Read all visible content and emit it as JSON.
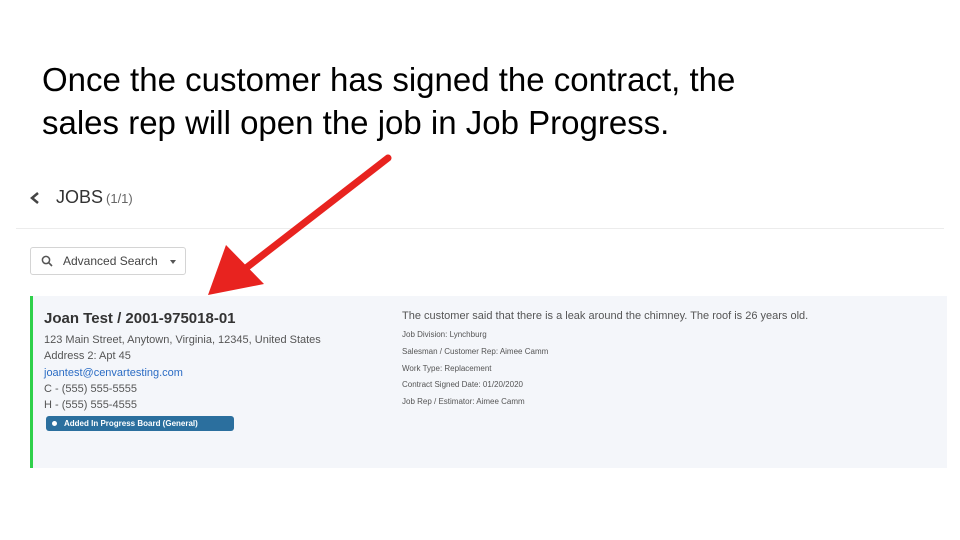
{
  "slide": {
    "line1": "Once the customer has signed the contract, the",
    "line2": "sales rep will open the job in Job Progress."
  },
  "header": {
    "title": "JOBS",
    "count": "(1/1)",
    "back_icon": "chevron-left-icon"
  },
  "search": {
    "label": "Advanced Search",
    "icon": "search-icon"
  },
  "job": {
    "title": "Joan Test / 2001-975018-01",
    "address": "123 Main Street, Anytown, Virginia, 12345, United States",
    "address2": "Address 2: Apt 45",
    "email": "joantest@cenvartesting.com",
    "phone_c": "C - (555) 555-5555",
    "phone_h": "H - (555) 555-4555",
    "badge": "Added In Progress Board (General)",
    "description": "The customer said that there is a leak around the chimney. The roof is 26 years old.",
    "division": "Job Division:  Lynchburg",
    "salesman": "Salesman / Customer Rep:  Aimee Camm",
    "work_type": "Work Type:  Replacement",
    "contract_date": "Contract Signed Date:  01/20/2020",
    "job_rep": "Job Rep / Estimator:  Aimee Camm"
  },
  "colors": {
    "accent_border": "#2fd04a",
    "badge": "#2b6f9e",
    "link": "#2b6cc4",
    "arrow": "#e8231f"
  }
}
